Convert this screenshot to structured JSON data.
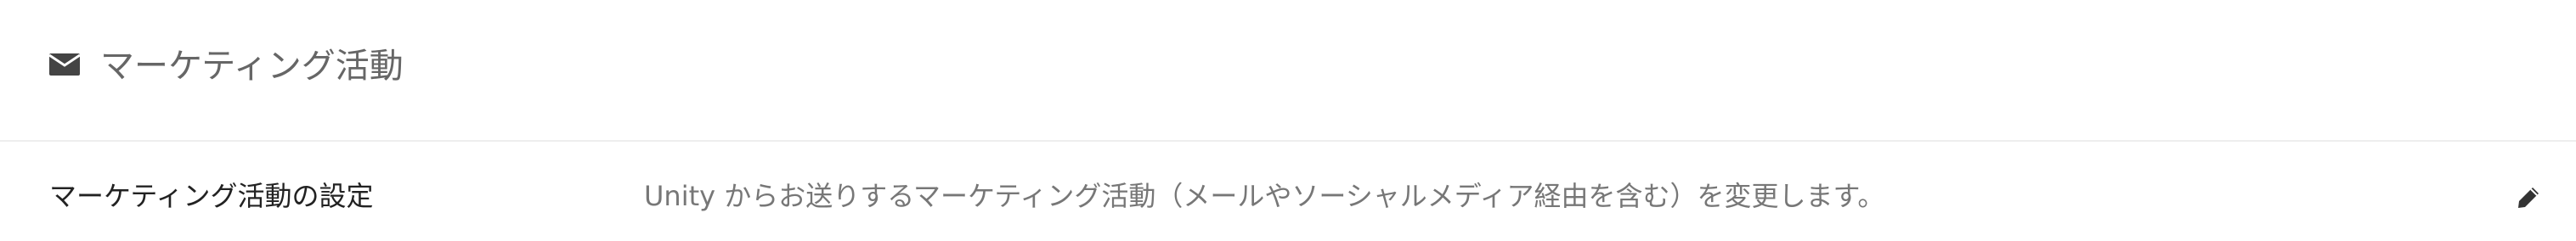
{
  "section": {
    "icon": "envelope-icon",
    "title": "マーケティング活動"
  },
  "setting": {
    "label": "マーケティング活動の設定",
    "description": "Unity からお送りするマーケティング活動（メールやソーシャルメディア経由を含む）を変更します。",
    "edit_icon": "pencil-icon"
  },
  "colors": {
    "header_text": "#666666",
    "label_text": "#222222",
    "description_text": "#777777",
    "icon": "#444444",
    "divider": "#eeeeee"
  }
}
